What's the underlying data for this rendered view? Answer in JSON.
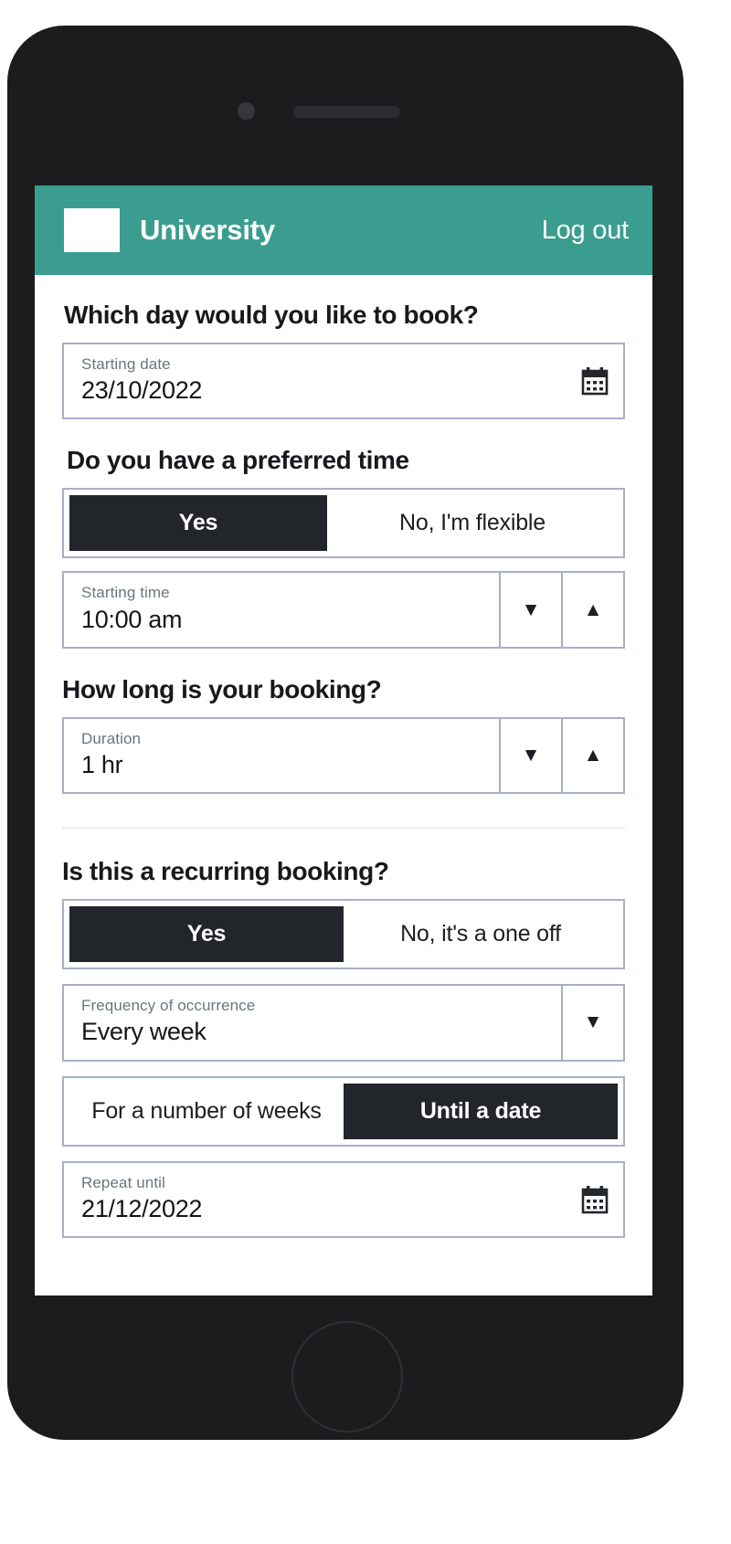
{
  "appbar": {
    "logo_name": "university-logo",
    "title": "University",
    "logout_label": "Log out",
    "background_color": "#3a9d8f",
    "text_color": "#ffffff"
  },
  "theme": {
    "accent": "#3a9d8f",
    "field_border": "#a6b0c9",
    "active_toggle_bg": "#22262b",
    "label_color": "#6c7482",
    "value_color": "#14161a"
  },
  "sections": {
    "day": {
      "question": "Which day would you like to book?",
      "starting_date": {
        "label": "Starting date",
        "value": "23/10/2022",
        "icon": "calendar-icon"
      }
    },
    "time": {
      "question": "Do you have a preferred time",
      "toggle": {
        "yes_label": "Yes",
        "no_label": "No, I'm flexible",
        "selected": "Yes"
      },
      "starting_time": {
        "label": "Starting time",
        "value": "10:00 am",
        "decrement_icon": "caret-down-icon",
        "increment_icon": "caret-up-icon",
        "decrement_glyph": "▼",
        "increment_glyph": "▲"
      }
    },
    "duration": {
      "question": "How long is your booking?",
      "field": {
        "label": "Duration",
        "value": "1 hr",
        "decrement_glyph": "▼",
        "increment_glyph": "▲"
      }
    },
    "recurring": {
      "question": "Is this a recurring booking?",
      "toggle": {
        "yes_label": "Yes",
        "no_label": "No, it's a one off",
        "selected": "Yes"
      },
      "frequency": {
        "label": "Frequency of occurrence",
        "value": "Every week",
        "dropdown_glyph": "▼"
      },
      "end_mode": {
        "weeks_label": "For a number of weeks",
        "date_label": "Until a date",
        "selected": "Until a date"
      },
      "repeat_until": {
        "label": "Repeat until",
        "value": "21/12/2022",
        "icon": "calendar-icon"
      }
    }
  }
}
